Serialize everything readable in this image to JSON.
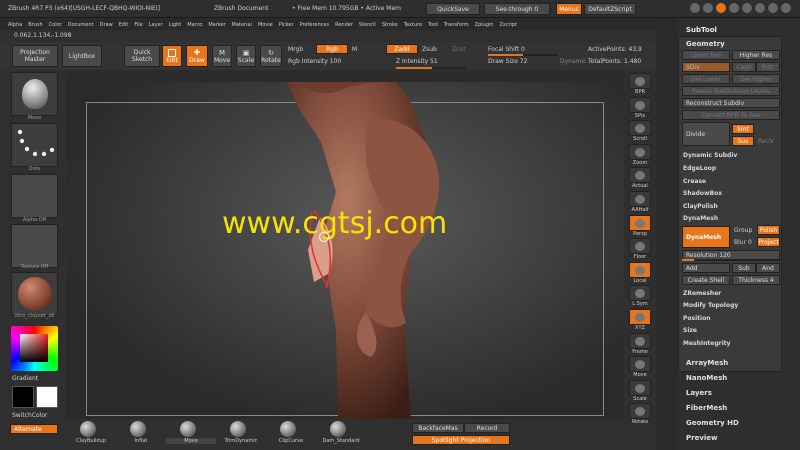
{
  "titlebar": {
    "app_title": "ZBrush 4R7 P3 (x64)[USGH-LECF-QBHQ-WIOI-NIEI]",
    "document": "ZBrush Document",
    "free_mem": "• Free Mem 10.795GB • Active Mem",
    "quicksave": "QuickSave",
    "see_through": "See-through 0",
    "menus": "Menus",
    "default_zscript": "DefaultZScript"
  },
  "menubar": [
    "Alpha",
    "Brush",
    "Color",
    "Document",
    "Draw",
    "Edit",
    "File",
    "Layer",
    "Light",
    "Macro",
    "Marker",
    "Material",
    "Movie",
    "Picker",
    "Preferences",
    "Render",
    "Stencil",
    "Stroke",
    "Texture",
    "Tool",
    "Transform",
    "Zplugin",
    "Zscript"
  ],
  "coords": "0.062,1.134,-1.098",
  "toolbar": {
    "projection_master": "Projection Master",
    "lightbox": "LightBox",
    "quick_sketch": "Quick Sketch",
    "edit": "Edit",
    "draw": "Draw",
    "move": "Move",
    "scale": "Scale",
    "rotate": "Rotate",
    "mrgb": "Mrgb",
    "rgb": "Rgb",
    "m": "M",
    "zadd": "Zadd",
    "zsub": "Zsub",
    "zcut": "Zcut",
    "rgb_intensity": "Rgb Intensity 100",
    "z_intensity": "Z Intensity 51",
    "focal_shift": "Focal Shift 0",
    "draw_size": "Draw Size 72",
    "dynamic": "Dynamic",
    "active_points": "ActivePoints: 43,9",
    "total_points": "TotalPoints: 1.480"
  },
  "left_shelf": {
    "brush_label": "Move",
    "stroke_label": "Dots",
    "alpha_label": "Alpha Off",
    "texture_label": "Texture Off",
    "material_label": "zbro_clayset_x6",
    "gradient": "Gradient",
    "switch_color": "SwitchColor",
    "alternate": "Alternate"
  },
  "canvas": {
    "watermark": "www.cgtsj.com"
  },
  "right_shelf": [
    {
      "id": "bpr",
      "label": "BPR"
    },
    {
      "id": "spix",
      "label": "SPix"
    },
    {
      "id": "scroll",
      "label": "Scroll"
    },
    {
      "id": "zoom",
      "label": "Zoom"
    },
    {
      "id": "actual",
      "label": "Actual"
    },
    {
      "id": "aahalf",
      "label": "AAHalf"
    },
    {
      "id": "persp",
      "label": "Persp"
    },
    {
      "id": "floor",
      "label": "Floor"
    },
    {
      "id": "local",
      "label": "Local"
    },
    {
      "id": "lsym",
      "label": "L.Sym"
    },
    {
      "id": "xyz",
      "label": "XYZ"
    },
    {
      "id": "frame",
      "label": "Frame"
    },
    {
      "id": "move",
      "label": "Move"
    },
    {
      "id": "scale",
      "label": "Scale"
    },
    {
      "id": "rotate",
      "label": "Rotate"
    }
  ],
  "subtool_panel": {
    "title": "SubTool",
    "geometry": "Geometry",
    "lower_res": "Lower Res",
    "higher_res": "Higher Res",
    "sdiv": "SDiv",
    "cage": "Cage",
    "rstr": "Rstr",
    "del_lower": "Del Lower",
    "del_higher": "Del Higher",
    "freeze": "Freeze SubDivision Levels",
    "reconstruct": "Reconstruct Subdiv",
    "convert_bpr": "Convert BPR To Geo",
    "divide": "Divide",
    "smt": "Smt",
    "suv": "Suv",
    "reuv": "ReUV",
    "dynamic_subdiv": "Dynamic Subdiv",
    "edgeloop": "EdgeLoop",
    "crease": "Crease",
    "shadowbox": "ShadowBox",
    "claypolish": "ClayPolish",
    "dynamesh_header": "DynaMesh",
    "dynamesh_btn": "DynaMesh",
    "group": "Group",
    "polish": "Polish",
    "blur": "Blur 0",
    "project": "Project",
    "resolution": "Resolution 120",
    "add": "Add",
    "sub": "Sub",
    "and": "And",
    "create_shell": "Create Shell",
    "thickness": "Thickness 4",
    "zremesher": "ZRemesher",
    "modify_topology": "Modify Topology",
    "position": "Position",
    "size": "Size",
    "meshintegrity": "MeshIntegrity",
    "arraymesh": "ArrayMesh",
    "nanomesh": "NanoMesh",
    "layers": "Layers",
    "fibermesh": "FiberMesh",
    "geometry_hd": "Geometry HD",
    "preview": "Preview"
  },
  "bottom_shelf": {
    "brushes": [
      "ClayBuildup",
      "Inflat",
      "Move",
      "TrimDynamic",
      "ClipCurve",
      "Dam_Standard"
    ],
    "backface": "BackfaceMas",
    "record": "Record",
    "spotlight": "Spotlight Projection"
  },
  "colors": {
    "accent": "#e8751a",
    "watermark": "#f5e400"
  }
}
